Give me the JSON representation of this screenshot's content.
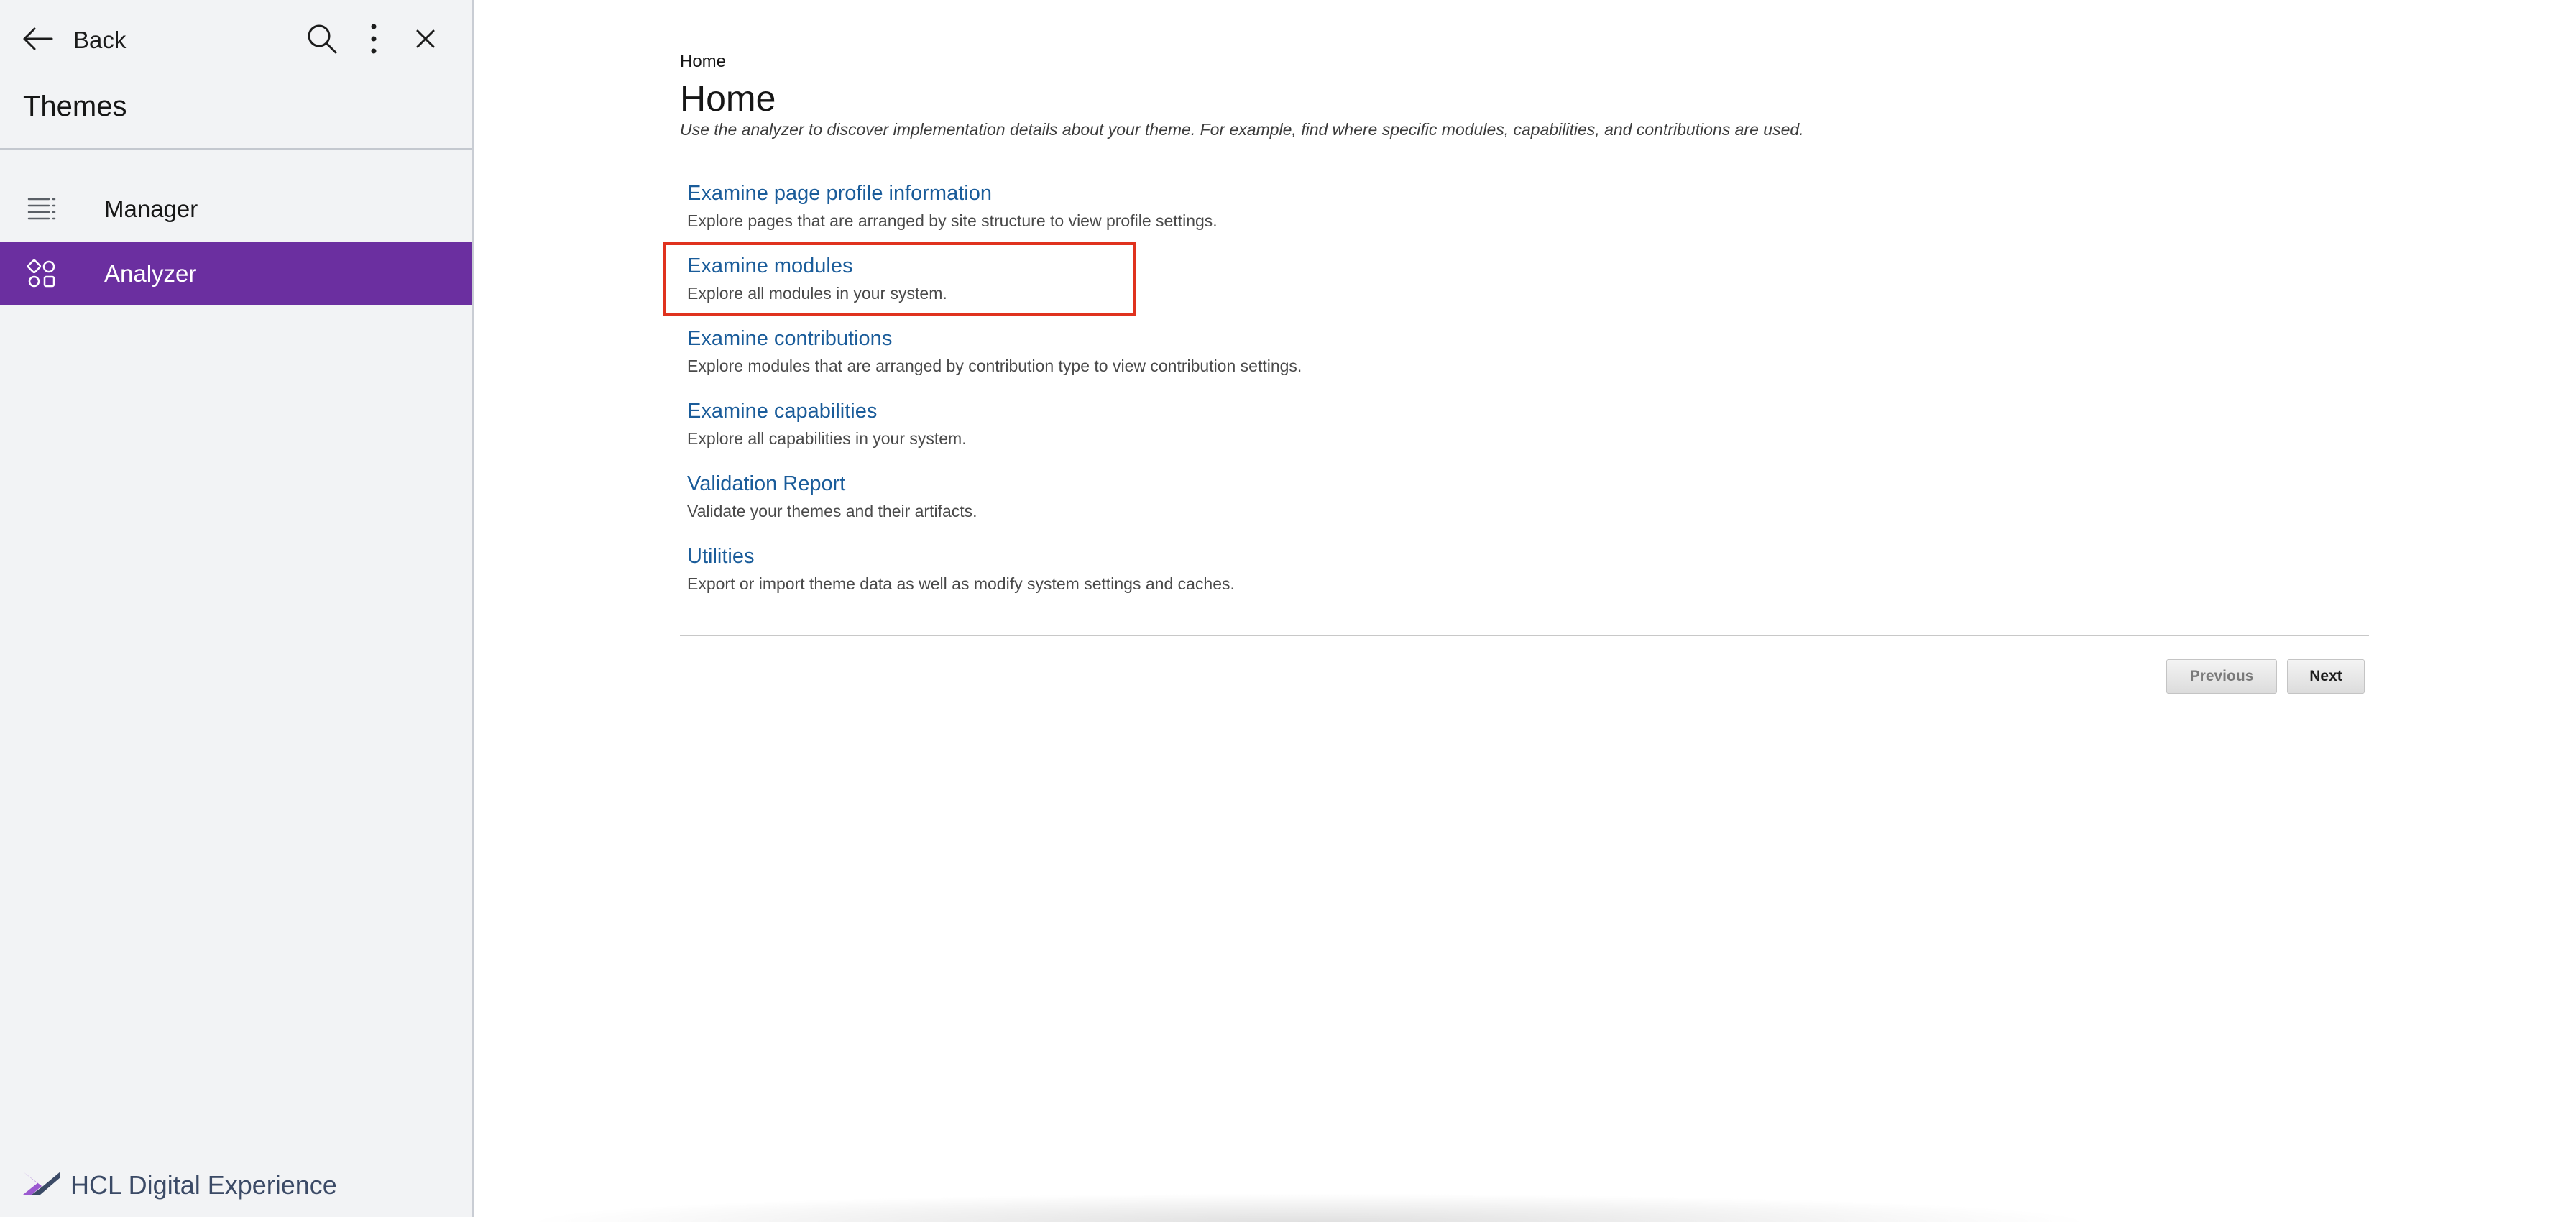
{
  "sidebar": {
    "back_label": "Back",
    "title": "Themes",
    "items": [
      {
        "label": "Manager",
        "icon": "list-icon",
        "active": false
      },
      {
        "label": "Analyzer",
        "icon": "analyzer-icon",
        "active": true
      }
    ],
    "brand": "HCL Digital Experience",
    "active_color": "#6b2fa0"
  },
  "main": {
    "breadcrumb": "Home",
    "title": "Home",
    "description": "Use the analyzer to discover implementation details about your theme. For example, find where specific modules, capabilities, and contributions are used.",
    "links": [
      {
        "title": "Examine page profile information",
        "desc": "Explore pages that are arranged by site structure to view profile settings."
      },
      {
        "title": "Examine modules",
        "desc": "Explore all modules in your system."
      },
      {
        "title": "Examine contributions",
        "desc": "Explore modules that are arranged by contribution type to view contribution settings."
      },
      {
        "title": "Examine capabilities",
        "desc": "Explore all capabilities in your system."
      },
      {
        "title": "Validation Report",
        "desc": "Validate your themes and their artifacts."
      },
      {
        "title": "Utilities",
        "desc": "Export or import theme data as well as modify system settings and caches."
      }
    ],
    "pager": {
      "previous": "Previous",
      "next": "Next"
    },
    "link_color": "#1a5c9a",
    "highlight_color": "#e0321e"
  }
}
